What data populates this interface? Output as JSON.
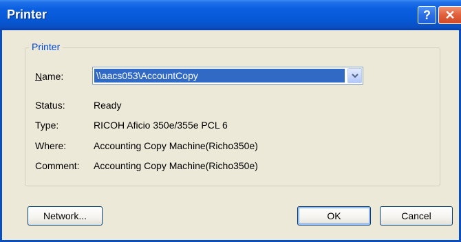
{
  "window": {
    "title": "Printer",
    "help_glyph": "?",
    "close_glyph": "✕"
  },
  "group": {
    "legend": "Printer"
  },
  "fields": {
    "name_label_mnemonic": "N",
    "name_label_rest": "ame:",
    "name_value": "\\\\aacs053\\AccountCopy",
    "status_label": "Status:",
    "status_value": "Ready",
    "type_label": "Type:",
    "type_value": "RICOH Aficio 350e/355e PCL 6",
    "where_label": "Where:",
    "where_value": "Accounting Copy Machine(Richo350e)",
    "comment_label": "Comment:",
    "comment_value": "Accounting Copy Machine(Richo350e)"
  },
  "buttons": {
    "network": "Network...",
    "ok": "OK",
    "cancel": "Cancel"
  },
  "colors": {
    "title_bar": "#0757d4",
    "selection": "#316ac5",
    "legend_text": "#0046d5",
    "dialog_bg": "#ece9d8"
  },
  "icons": {
    "help": "help-icon",
    "close": "close-icon",
    "dropdown": "chevron-down-icon"
  }
}
